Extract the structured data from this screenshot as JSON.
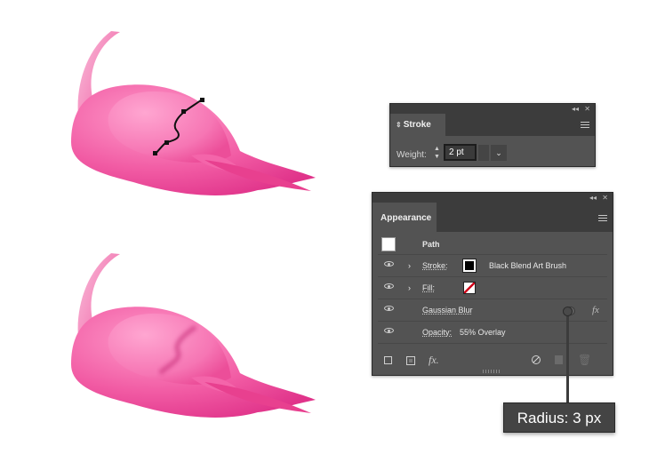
{
  "stroke_panel": {
    "collapse_glyph": "◂◂",
    "close_glyph": "✕",
    "tab_label": "Stroke",
    "weight_label": "Weight:",
    "weight_value": "2 pt"
  },
  "appearance_panel": {
    "collapse_glyph": "◂◂",
    "close_glyph": "✕",
    "tab_label": "Appearance",
    "path_label": "Path",
    "stroke_label": "Stroke:",
    "stroke_value": "Black Blend Art Brush",
    "fill_label": "Fill:",
    "effect_label": "Gaussian Blur",
    "fx_label": "fx",
    "opacity_label": "Opacity:",
    "opacity_value": "55% Overlay",
    "add_effect_label": "fx."
  },
  "tooltip": {
    "text": "Radius: 3 px"
  },
  "colors": {
    "panel_bg": "#535353",
    "panel_dark": "#3c3c3c",
    "flamingo_pink": "#f04f9c",
    "flamingo_light": "#ff8fc4",
    "flamingo_dark": "#d12a76"
  }
}
